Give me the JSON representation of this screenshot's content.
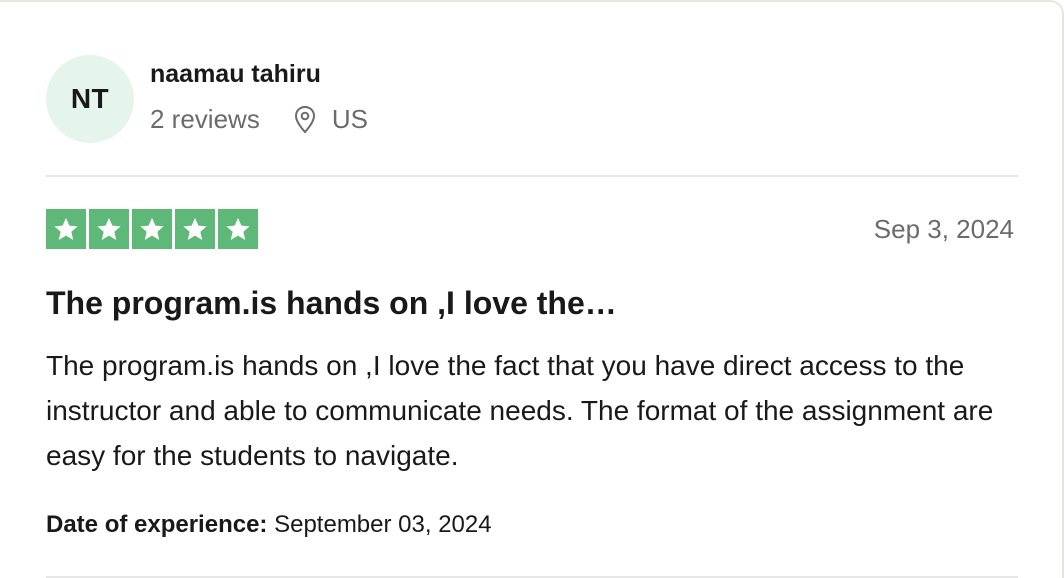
{
  "consumer": {
    "initials": "NT",
    "name": "naamau tahiru",
    "reviews_count": "2 reviews",
    "location": "US"
  },
  "review": {
    "rating": 5,
    "rating_max": 5,
    "star_color": "#5eb878",
    "date": "Sep 3, 2024",
    "title": "The program.is hands on ,I love the…",
    "body": "The program.is hands on ,I love the fact that you have direct access to the instructor and able to communicate needs. The format of the assignment are easy for the students to navigate.",
    "experience_label": "Date of experience:",
    "experience_date": "September 03, 2024"
  },
  "icons": {
    "location": "location-pin-icon",
    "star": "star-icon"
  }
}
